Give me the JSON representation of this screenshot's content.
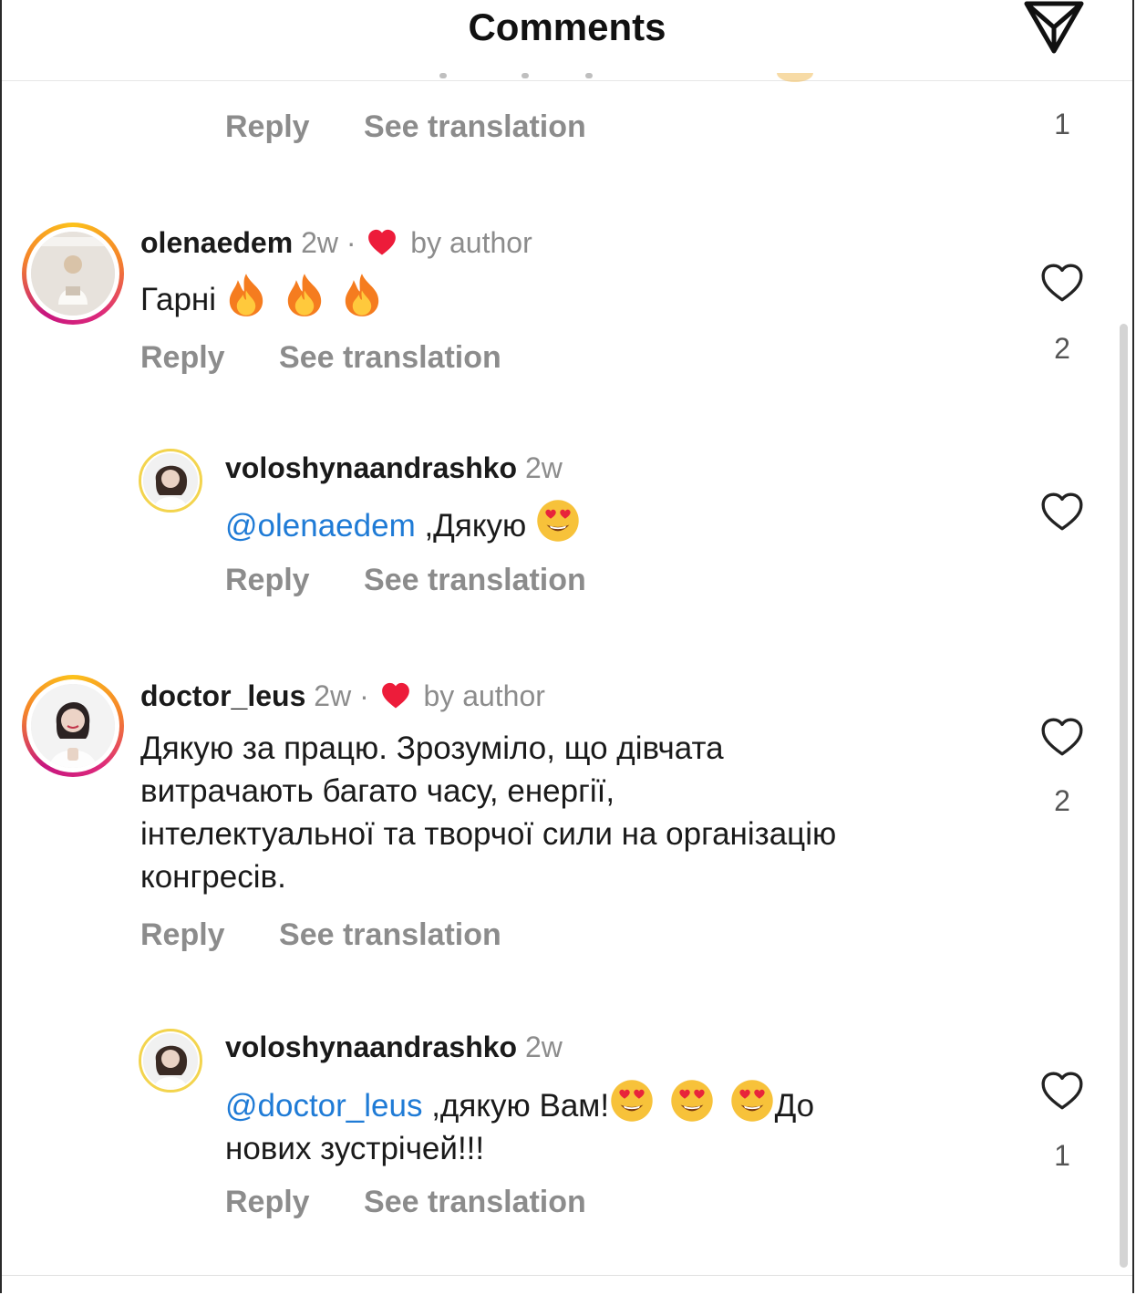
{
  "header": {
    "title": "Comments",
    "send_icon": "paper-plane-icon"
  },
  "previous_comment": {
    "actions": {
      "reply": "Reply",
      "translate": "See translation"
    },
    "likes": "1"
  },
  "comments": [
    {
      "username": "olenaedem",
      "time": "2w",
      "separator": "·",
      "liked_by": "by author",
      "text": "Гарні",
      "emojis": [
        "fire",
        "fire",
        "fire"
      ],
      "actions": {
        "reply": "Reply",
        "translate": "See translation"
      },
      "likes": "2",
      "replies": [
        {
          "username": "voloshynaandrashko",
          "time": "2w",
          "mention": "@olenaedem",
          "text": " ,Дякую ",
          "emojis": [
            "heart-eyes"
          ],
          "actions": {
            "reply": "Reply",
            "translate": "See translation"
          },
          "likes": ""
        }
      ]
    },
    {
      "username": "doctor_leus",
      "time": "2w",
      "separator": "·",
      "liked_by": "by author",
      "text_lines": [
        "Дякую за працю. Зрозуміло, що дівчата",
        "витрачають багато часу, енергії,",
        "інтелектуальної та творчої сили на організацію",
        "конгресів."
      ],
      "actions": {
        "reply": "Reply",
        "translate": "See translation"
      },
      "likes": "2",
      "replies": [
        {
          "username": "voloshynaandrashko",
          "time": "2w",
          "mention": "@doctor_leus",
          "text_a": " ,дякую Вам!",
          "text_b": "До",
          "text_line2": "нових зустрічей!!!",
          "emojis": [
            "heart-eyes",
            "heart-eyes",
            "heart-eyes"
          ],
          "actions": {
            "reply": "Reply",
            "translate": "See translation"
          },
          "likes": "1"
        }
      ]
    }
  ],
  "colors": {
    "mention": "#1f7bd6",
    "heart": "#ed1c3a",
    "muted": "#8c8c8c"
  }
}
